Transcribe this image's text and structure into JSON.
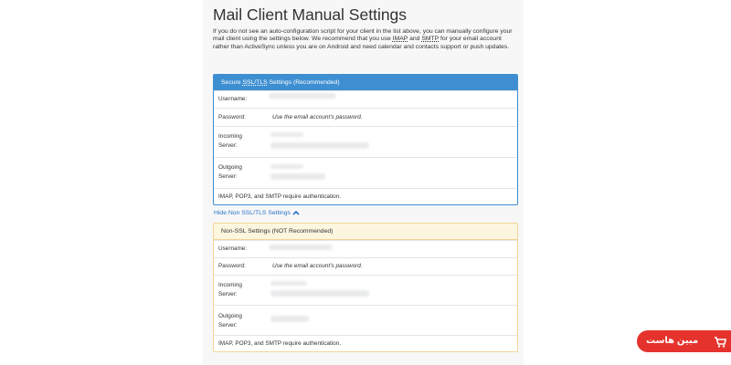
{
  "page": {
    "title": "Mail Client Manual Settings",
    "intro_1": "If you do not see an auto-configuration script for your client in the list above, you can manually configure your mail client using the settings below. We recommend that you use ",
    "intro_imap": "IMAP",
    "intro_and": " and ",
    "intro_smtp": "SMTP",
    "intro_2": " for your email account rather than ActiveSync unless you are on Android and need calendar and contacts support or push updates."
  },
  "secure": {
    "heading_prefix": "Secure ",
    "heading_abbr": "SSL/TLS",
    "heading_suffix": " Settings (Recommended)",
    "username_label": "Username:",
    "password_label": "Password:",
    "password_value": "Use the email account’s password.",
    "incoming_label_1": "Incoming",
    "incoming_label_2": "Server:",
    "outgoing_label_1": "Outgoing",
    "outgoing_label_2": "Server:",
    "auth_note": "IMAP, POP3, and SMTP require authentication."
  },
  "toggle": {
    "label": "Hide Non SSL/TLS Settings"
  },
  "nonssl": {
    "heading": "Non-SSL Settings (NOT Recommended)",
    "username_label": "Username:",
    "password_label": "Password:",
    "password_value": "Use the email account’s password.",
    "incoming_label_1": "Incoming",
    "incoming_label_2": "Server:",
    "outgoing_label_1": "Outgoing",
    "outgoing_label_2": "Server:",
    "auth_note": "IMAP, POP3, and SMTP require authentication."
  },
  "watermark": {
    "text": "مبین هاست"
  },
  "colors": {
    "secure_accent": "#3d8fd1",
    "nonssl_border": "#f2d597",
    "nonssl_head_bg": "#fdf6df",
    "link": "#2a73c9",
    "watermark_bg": "#e5322d"
  }
}
